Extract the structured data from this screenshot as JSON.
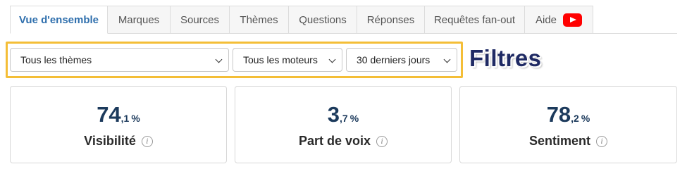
{
  "tabs": [
    {
      "label": "Vue d'ensemble",
      "active": true
    },
    {
      "label": "Marques"
    },
    {
      "label": "Sources"
    },
    {
      "label": "Thèmes"
    },
    {
      "label": "Questions"
    },
    {
      "label": "Réponses"
    },
    {
      "label": "Requêtes fan-out"
    },
    {
      "label": "Aide",
      "icon": "youtube-icon"
    }
  ],
  "filters": {
    "theme_value": "Tous les thèmes",
    "engine_value": "Tous les moteurs",
    "period_value": "30 derniers jours",
    "annotation": "Filtres",
    "highlight_color": "#f4be37"
  },
  "metrics": [
    {
      "int": "74",
      "dec": ",1",
      "unit": "%",
      "label": "Visibilité"
    },
    {
      "int": "3",
      "dec": ",7",
      "unit": "%",
      "label": "Part de voix"
    },
    {
      "int": "78",
      "dec": ",2",
      "unit": "%",
      "label": "Sentiment"
    }
  ],
  "colors": {
    "active_tab_text": "#2f6fad",
    "metric_value": "#1c3a5c",
    "annotation_text": "#1f2a64",
    "youtube_red": "#ff0000"
  }
}
